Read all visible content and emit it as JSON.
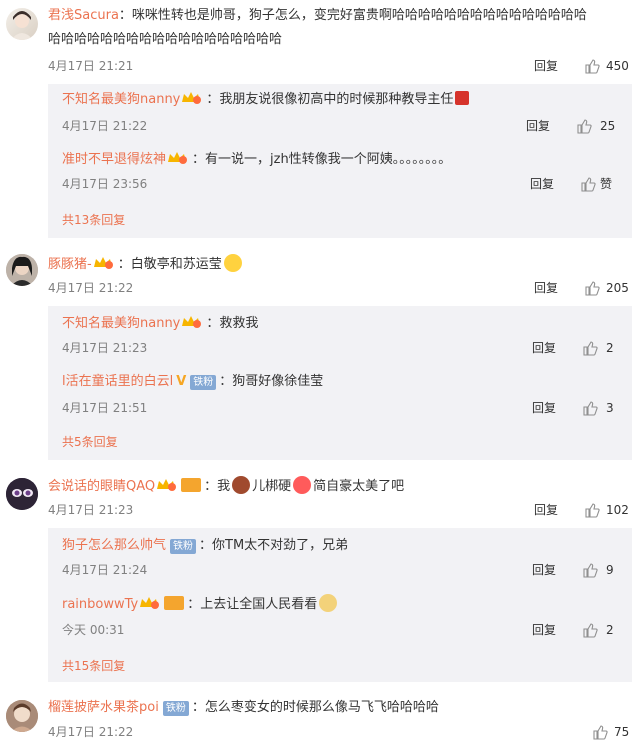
{
  "colors": {
    "username": "#eb7350",
    "text": "#333333",
    "meta": "#808080",
    "reply_bg": "#f2f2f5"
  },
  "icons": {
    "like": "thumbs-up-icon",
    "vip": "vip-crown-badge-icon",
    "iron_fan": "iron-fan-badge"
  },
  "comments": [
    {
      "user": "君浅Sacura",
      "text_line1": "：咪咪性转也是帅哥，狗子怎么，变完好富贵啊哈哈哈哈哈哈哈哈哈哈哈哈哈哈哈",
      "text_line2": "哈哈哈哈哈哈哈哈哈哈哈哈哈哈哈哈哈哈",
      "time": "4月17日 21:21",
      "reply_label": "回复",
      "likes": "450",
      "replies": [
        {
          "user": "不知名最美狗nanny",
          "text": "：我朋友说很像初高中的时候那种教导主任",
          "time": "4月17日 21:22",
          "reply_label": "回复",
          "likes": "25"
        },
        {
          "user": "准时不早退得炫神",
          "text": "：有一说一，jzh性转像我一个阿姨。。。。。。。。",
          "time": "4月17日 23:56",
          "reply_label": "回复",
          "likes": "赞"
        }
      ],
      "more": "共13条回复"
    },
    {
      "user": "豚豚猪-",
      "text_line1": "：白敬亭和苏运莹",
      "time": "4月17日 21:22",
      "reply_label": "回复",
      "likes": "205",
      "replies": [
        {
          "user": "不知名最美狗nanny",
          "text": "：救救我",
          "time": "4月17日 21:23",
          "reply_label": "回复",
          "likes": "2"
        },
        {
          "user": "l活在童话里的白云l",
          "badge": "铁粉",
          "text": "：狗哥好像徐佳莹",
          "time": "4月17日 21:51",
          "reply_label": "回复",
          "likes": "3"
        }
      ],
      "more": "共5条回复"
    },
    {
      "user": "会说话的眼睛QAQ",
      "text_pre": "：我",
      "text_mid": "儿梆硬",
      "text_post": "简自豪太美了吧",
      "time": "4月17日 21:23",
      "reply_label": "回复",
      "likes": "102",
      "replies": [
        {
          "user": "狗子怎么那么帅气",
          "badge": "铁粉",
          "text": "：你TM太不对劲了，兄弟",
          "time": "4月17日 21:24",
          "reply_label": "回复",
          "likes": "9"
        },
        {
          "user": "rainbowwTy",
          "text": "：上去让全国人民看看",
          "time": "今天 00:31",
          "reply_label": "回复",
          "likes": "2"
        }
      ],
      "more": "共15条回复"
    },
    {
      "user": "榴莲披萨水果茶poi",
      "badge": "铁粉",
      "text_line1": "：怎么枣变女的时候那么像马飞飞哈哈哈哈",
      "time": "4月17日 21:22",
      "likes": "75"
    }
  ]
}
